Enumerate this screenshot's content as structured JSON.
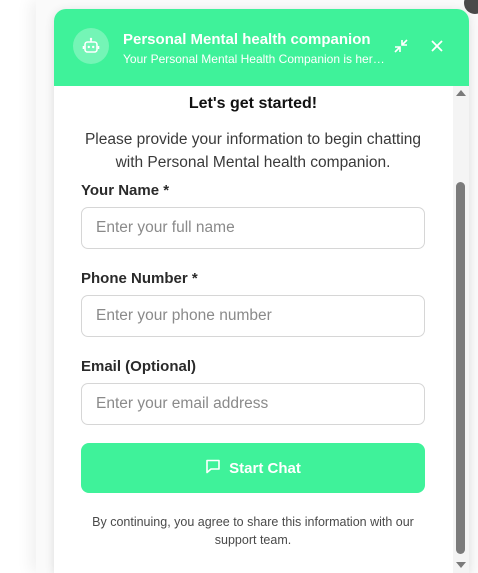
{
  "header": {
    "title": "Personal Mental health companion",
    "subtitle": "Your Personal Mental Health Companion is here to help"
  },
  "form": {
    "heading": "Let's get started!",
    "intro": "Please provide your information to begin chatting with Personal Mental health companion.",
    "name_label": "Your Name *",
    "name_placeholder": "Enter your full name",
    "phone_label": "Phone Number *",
    "phone_placeholder": "Enter your phone number",
    "email_label": "Email (Optional)",
    "email_placeholder": "Enter your email address",
    "submit_label": "Start Chat",
    "footer_note": "By continuing, you agree to share this information with our support team."
  },
  "icons": {
    "avatar": "robot-icon",
    "minimize": "minimize-icon",
    "close": "close-icon",
    "submit": "chat-bubble-icon"
  },
  "colors": {
    "accent": "#3ff29a"
  }
}
